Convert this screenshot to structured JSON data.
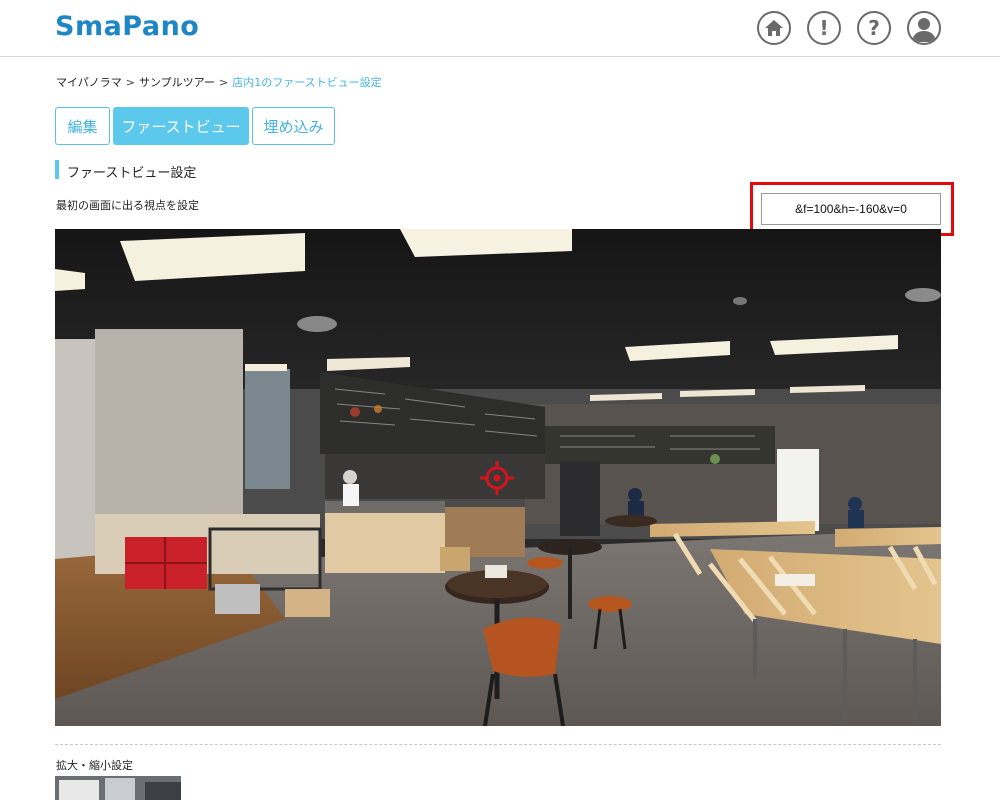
{
  "app": {
    "logo": "SmaPano"
  },
  "header": {
    "icons": [
      "home-icon",
      "exclamation-icon",
      "question-icon",
      "user-icon"
    ],
    "exclamation_glyph": "!",
    "question_glyph": "?"
  },
  "breadcrumb": {
    "items": [
      "マイパノラマ",
      "サンプルツアー",
      "店内1のファーストビュー設定"
    ],
    "separator": ">"
  },
  "tabs": [
    {
      "label": "編集",
      "active": false
    },
    {
      "label": "ファーストビュー",
      "active": true
    },
    {
      "label": "埋め込み",
      "active": false
    }
  ],
  "section": {
    "title": "ファーストビュー設定",
    "description": "最初の画面に出る視点を設定",
    "param_value": "&f=100&h=-160&v=0"
  },
  "zoom": {
    "title": "拡大・縮小設定"
  },
  "colors": {
    "brand": "#1f86c5",
    "accent": "#5bc8ec",
    "highlight": "#e10b0b",
    "crosshair": "#d4141c"
  }
}
